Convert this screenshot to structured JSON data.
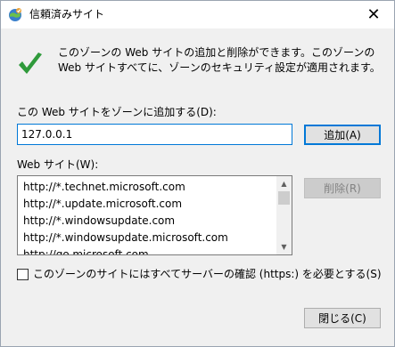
{
  "window": {
    "title": "信頼済みサイト",
    "close_glyph": "✕"
  },
  "info": {
    "message": "このゾーンの Web サイトの追加と削除ができます。このゾーンの Web サイトすべてに、ゾーンのセキュリティ設定が適用されます。"
  },
  "add_zone": {
    "label": "この Web サイトをゾーンに追加する(D):",
    "input_value": "127.0.0.1",
    "add_button": "追加(A)"
  },
  "sites": {
    "label": "Web サイト(W):",
    "items": [
      "http://*.technet.microsoft.com",
      "http://*.update.microsoft.com",
      "http://*.windowsupdate.com",
      "http://*.windowsupdate.microsoft.com",
      "http://go.microsoft.com"
    ],
    "remove_button": "削除(R)"
  },
  "https_option": {
    "label": "このゾーンのサイトにはすべてサーバーの確認 (https:) を必要とする(S)",
    "checked": false
  },
  "footer": {
    "close_button": "閉じる(C)"
  },
  "colors": {
    "accent": "#0078d7",
    "check_green": "#2f9a3b",
    "dialog_bg": "#f0f0f0"
  },
  "icons": {
    "title": "internet-options-globe-icon",
    "info": "checkmark-icon",
    "close": "close-icon"
  }
}
